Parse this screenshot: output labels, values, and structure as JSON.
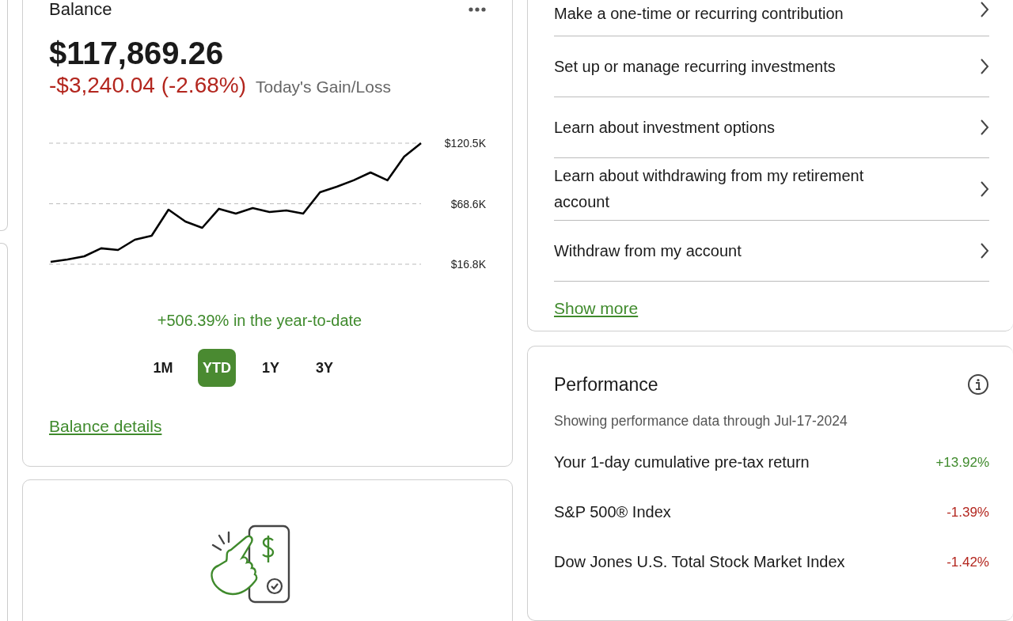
{
  "balance": {
    "title": "Balance",
    "amount": "$117,869.26",
    "change": "-$3,240.04 (-2.68%)",
    "change_label": "Today's Gain/Loss",
    "chart_data": {
      "type": "line",
      "ylim": [
        16.8,
        120.5
      ],
      "yticks": [
        {
          "value": 120.5,
          "label": "$120.5K"
        },
        {
          "value": 68.6,
          "label": "$68.6K"
        },
        {
          "value": 16.8,
          "label": "$16.8K"
        }
      ],
      "values": [
        18.8,
        20.9,
        23.6,
        30.4,
        29.0,
        37.8,
        41.2,
        63.6,
        53.4,
        48.0,
        64.3,
        60.2,
        64.9,
        61.5,
        62.9,
        60.2,
        78.5,
        83.2,
        88.7,
        95.4,
        88.7,
        109.0,
        120.5
      ]
    },
    "summary": "+506.39% in the year-to-date",
    "ranges": [
      {
        "label": "1M",
        "selected": false
      },
      {
        "label": "YTD",
        "selected": true
      },
      {
        "label": "1Y",
        "selected": false
      },
      {
        "label": "3Y",
        "selected": false
      }
    ],
    "details_link": "Balance details"
  },
  "actions": {
    "items": [
      "Make a one-time or recurring contribution",
      "Set up or manage recurring investments",
      "Learn about investment options",
      "Learn about withdrawing from my retirement account",
      "Withdraw from my account"
    ],
    "more_link": "Show more"
  },
  "performance": {
    "title": "Performance",
    "note": "Showing performance data through Jul-17-2024",
    "rows": [
      {
        "label": "Your 1-day cumulative pre-tax return",
        "value": "+13.92%",
        "color": "#3f8a2c"
      },
      {
        "label": "S&P 500® Index",
        "value": "-1.39%",
        "color": "#b3261e"
      },
      {
        "label": "Dow Jones U.S. Total Stock Market Index",
        "value": "-1.42%",
        "color": "#b3261e"
      }
    ]
  }
}
